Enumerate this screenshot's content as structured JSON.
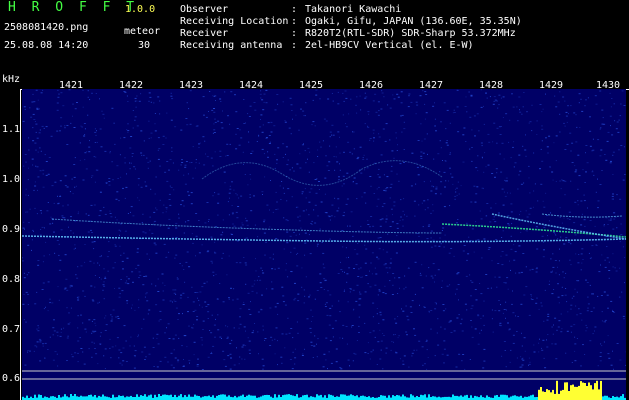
{
  "header": {
    "app_title": "H R O F F T",
    "app_version": "1.0.0",
    "file_name": "2508081420.png",
    "timestamp": "25.08.08 14:20",
    "meteor_label": "meteor",
    "meteor_count": "30"
  },
  "info": [
    {
      "label": "Observer",
      "value": "Takanori Kawachi"
    },
    {
      "label": "Receiving Location",
      "value": "Ogaki, Gifu, JAPAN (136.60E, 35.35N)"
    },
    {
      "label": "Receiver",
      "value": "R820T2(RTL-SDR) SDR-Sharp 53.372MHz"
    },
    {
      "label": "Receiving antenna",
      "value": "2el-HB9CV Vertical (el. E-W)"
    }
  ],
  "axis": {
    "y_unit": "kHz",
    "y_ticks": [
      "1.1",
      "1.0",
      "0.9",
      "0.8",
      "0.7",
      "0.6"
    ],
    "x_ticks": [
      "1421",
      "1422",
      "1423",
      "1424",
      "1425",
      "1426",
      "1427",
      "1428",
      "1429",
      "1430"
    ]
  },
  "colors": {
    "background": "#000000",
    "plot_bg": "#000066",
    "noise": "#2244cc",
    "trace": "#66ccff",
    "bar": "#00e5ff",
    "burst": "#ffff33",
    "title_green": "#44ff44",
    "version_yellow": "#ffff55"
  }
}
